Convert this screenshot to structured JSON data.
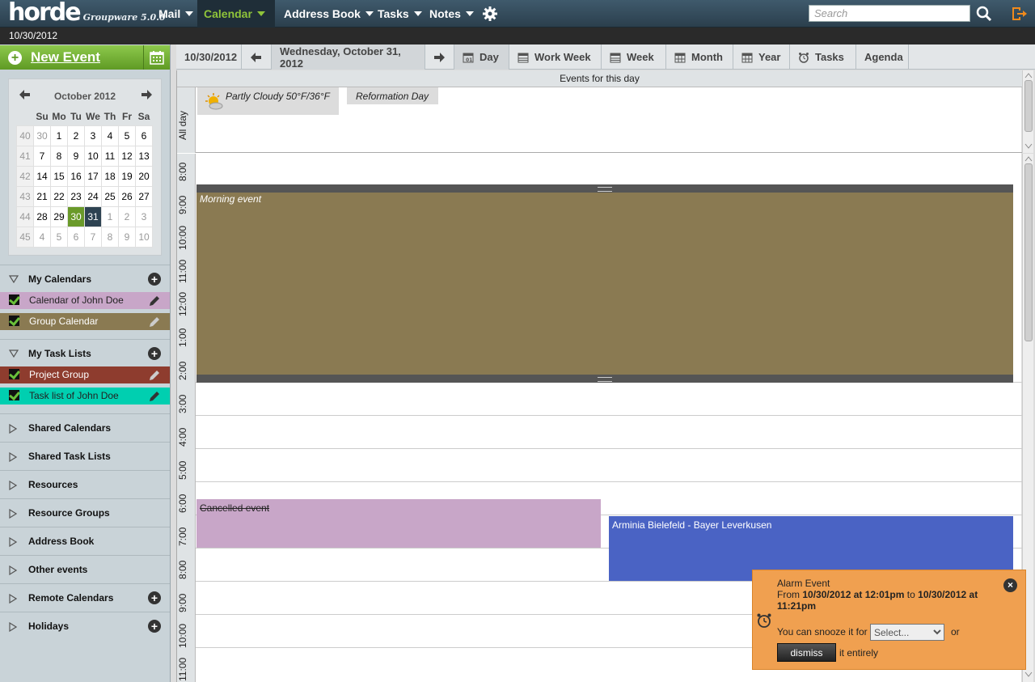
{
  "app": {
    "logo": "horde",
    "version": "Groupware 5.0.0"
  },
  "menu": [
    {
      "label": "Mail"
    },
    {
      "label": "Calendar"
    },
    {
      "label": "Address Book"
    },
    {
      "label": "Tasks"
    },
    {
      "label": "Notes"
    }
  ],
  "search": {
    "placeholder": "Search"
  },
  "current_date": "10/30/2012",
  "sidebar": {
    "new_event": "New Event",
    "minical": {
      "title": "October 2012",
      "weekdays": [
        "Su",
        "Mo",
        "Tu",
        "We",
        "Th",
        "Fr",
        "Sa"
      ],
      "weeks": [
        {
          "wk": "40",
          "days": [
            "30",
            "1",
            "2",
            "3",
            "4",
            "5",
            "6"
          ]
        },
        {
          "wk": "41",
          "days": [
            "7",
            "8",
            "9",
            "10",
            "11",
            "12",
            "13"
          ]
        },
        {
          "wk": "42",
          "days": [
            "14",
            "15",
            "16",
            "17",
            "18",
            "19",
            "20"
          ]
        },
        {
          "wk": "43",
          "days": [
            "21",
            "22",
            "23",
            "24",
            "25",
            "26",
            "27"
          ]
        },
        {
          "wk": "44",
          "days": [
            "28",
            "29",
            "30",
            "31",
            "1",
            "2",
            "3"
          ]
        },
        {
          "wk": "45",
          "days": [
            "4",
            "5",
            "6",
            "7",
            "8",
            "9",
            "10"
          ]
        }
      ]
    },
    "my_calendars": {
      "label": "My Calendars",
      "items": [
        {
          "name": "Calendar of John Doe",
          "color": "#c8a6c8"
        },
        {
          "name": "Group Calendar",
          "color": "#8a7a52"
        }
      ]
    },
    "my_task_lists": {
      "label": "My Task Lists",
      "items": [
        {
          "name": "Project Group",
          "color": "#8e3c2e"
        },
        {
          "name": "Task list of John Doe",
          "color": "#00cfb0"
        }
      ]
    },
    "sections": [
      "Shared Calendars",
      "Shared Task Lists",
      "Resources",
      "Resource Groups",
      "Address Book",
      "Other events",
      "Remote Calendars",
      "Holidays"
    ]
  },
  "viewbar": {
    "today": "10/30/2012",
    "current": "Wednesday, October 31, 2012",
    "views": [
      "Day",
      "Work Week",
      "Week",
      "Month",
      "Year",
      "Tasks",
      "Agenda"
    ]
  },
  "grid": {
    "header": "Events for this day",
    "allday_label": "All day",
    "weather": "Partly Cloudy 50°F/36°F",
    "holiday": "Reformation Day",
    "hours": [
      "8:00",
      "9:00",
      "10:00",
      "11:00",
      "12:00",
      "1:00",
      "2:00",
      "3:00",
      "4:00",
      "5:00",
      "6:00",
      "7:00",
      "8:00",
      "9:00",
      "10:00",
      "11:00"
    ],
    "events": {
      "morning": {
        "title": "Morning event",
        "color": "#8a7a52"
      },
      "cancelled": {
        "title": "Cancelled event",
        "color": "#c8a6c8"
      },
      "match": {
        "title": "Arminia Bielefeld - Bayer Leverkusen",
        "color": "#4a63c4"
      }
    }
  },
  "alarm": {
    "title": "Alarm Event",
    "from_label": "From",
    "from": "10/30/2012 at 12:01pm",
    "to_label": "to",
    "to": "10/30/2012 at 11:21pm",
    "snooze_label": "You can snooze it for",
    "select_value": "Select...",
    "or": "or",
    "dismiss": "dismiss",
    "entirely": "it entirely"
  }
}
